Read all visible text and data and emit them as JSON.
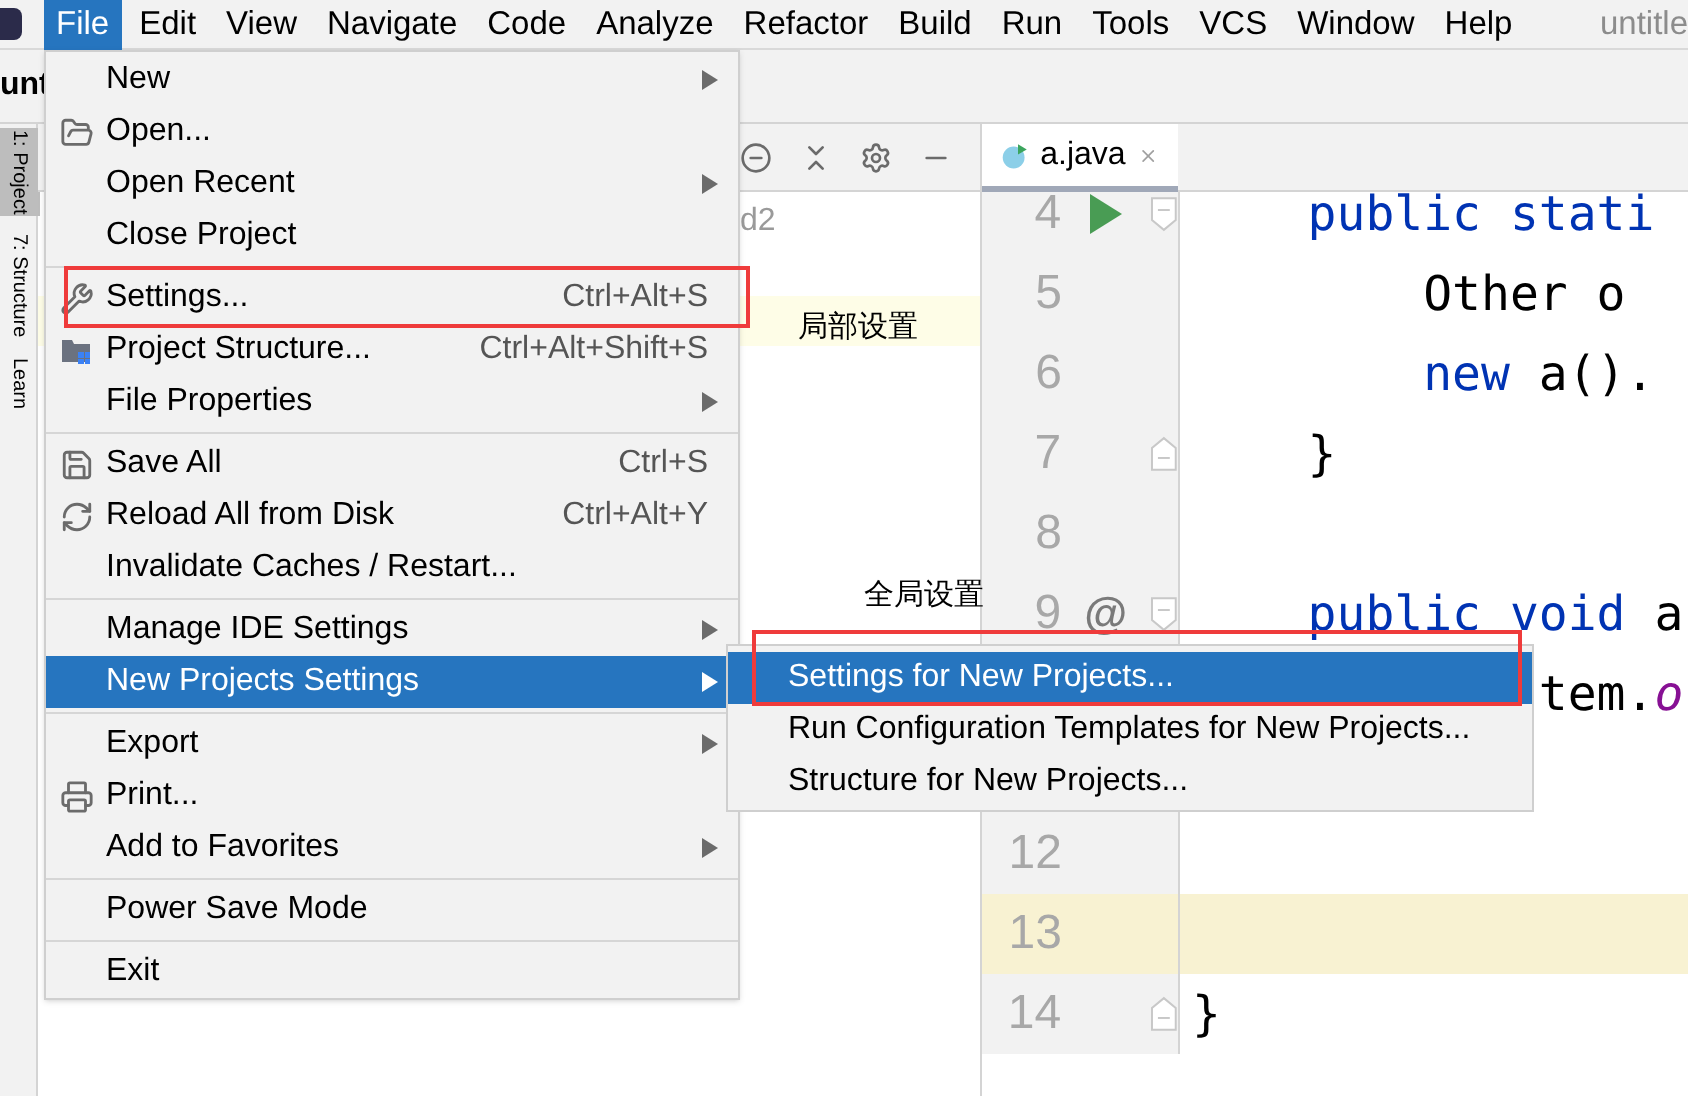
{
  "menubar": {
    "items": [
      {
        "label": "File",
        "selected": true
      },
      {
        "label": "Edit",
        "selected": false
      },
      {
        "label": "View",
        "selected": false
      },
      {
        "label": "Navigate",
        "selected": false
      },
      {
        "label": "Code",
        "selected": false
      },
      {
        "label": "Analyze",
        "selected": false
      },
      {
        "label": "Refactor",
        "selected": false
      },
      {
        "label": "Build",
        "selected": false
      },
      {
        "label": "Run",
        "selected": false
      },
      {
        "label": "Tools",
        "selected": false
      },
      {
        "label": "VCS",
        "selected": false
      },
      {
        "label": "Window",
        "selected": false
      },
      {
        "label": "Help",
        "selected": false
      }
    ],
    "window_title": "untitle"
  },
  "project_title": "unt",
  "tool_strip": [
    {
      "label": "1: Project",
      "selected": true
    },
    {
      "label": "7: Structure",
      "selected": false
    },
    {
      "label": "Learn",
      "selected": false
    }
  ],
  "project_panel": {
    "rows": [
      {
        "label": "d2",
        "highlighted": false
      },
      {
        "highlighted": false
      },
      {
        "highlighted": true
      }
    ]
  },
  "editor": {
    "tab": {
      "label": "a.java"
    },
    "lines": [
      {
        "number": "4",
        "kind": "run",
        "fold_start": true,
        "fold_end": false,
        "current": false,
        "tokens": [
          {
            "text": "    public stati",
            "kind": "keyword"
          }
        ]
      },
      {
        "number": "5",
        "kind": "plain",
        "fold_start": false,
        "fold_end": false,
        "current": false,
        "tokens": [
          {
            "text": "        Other o",
            "kind": "plain"
          }
        ]
      },
      {
        "number": "6",
        "kind": "plain",
        "fold_start": false,
        "fold_end": false,
        "current": false,
        "tokens": [
          {
            "text": "        new",
            "kind": "keyword"
          },
          {
            "text": " a().",
            "kind": "plain"
          }
        ]
      },
      {
        "number": "7",
        "kind": "plain",
        "fold_start": false,
        "fold_end": true,
        "current": false,
        "tokens": [
          {
            "text": "    }",
            "kind": "plain"
          }
        ]
      },
      {
        "number": "8",
        "kind": "plain",
        "fold_start": false,
        "fold_end": false,
        "current": false
      },
      {
        "number": "9",
        "kind": "override",
        "gutter_text": "@",
        "fold_start": true,
        "fold_end": false,
        "current": false,
        "tokens": [
          {
            "text": "    public void",
            "kind": "keyword"
          },
          {
            "text": " a",
            "kind": "plain"
          }
        ]
      },
      {
        "kind": "plain",
        "fold_start": false,
        "fold_end": false,
        "current": false,
        "tokens": [
          {
            "text": "            tem.",
            "kind": "plain"
          },
          {
            "text": "o",
            "kind": "field"
          }
        ]
      },
      {
        "kind": "plain",
        "fold_start": false,
        "fold_end": false,
        "current": false
      },
      {
        "number": "12",
        "kind": "plain",
        "fold_start": false,
        "fold_end": false,
        "current": false
      },
      {
        "number": "13",
        "kind": "plain",
        "fold_start": false,
        "fold_end": false,
        "current": true
      },
      {
        "number": "14",
        "kind": "plain",
        "fold_start": false,
        "fold_end": true,
        "current": false,
        "tokens": [
          {
            "text": "}",
            "kind": "plain"
          }
        ]
      }
    ]
  },
  "file_menu": {
    "groups": [
      [
        {
          "label": "New",
          "submenu": true,
          "selected": false
        },
        {
          "label": "Open...",
          "submenu": false,
          "selected": false
        },
        {
          "label": "Open Recent",
          "submenu": true,
          "selected": false
        },
        {
          "label": "Close Project",
          "submenu": false,
          "selected": false
        }
      ],
      [
        {
          "label": "Settings...",
          "shortcut": "Ctrl+Alt+S",
          "submenu": false,
          "selected": false
        },
        {
          "label": "Project Structure...",
          "shortcut": "Ctrl+Alt+Shift+S",
          "submenu": false,
          "selected": false
        },
        {
          "label": "File Properties",
          "submenu": true,
          "selected": false
        }
      ],
      [
        {
          "label": "Save All",
          "shortcut": "Ctrl+S",
          "submenu": false,
          "selected": false
        },
        {
          "label": "Reload All from Disk",
          "shortcut": "Ctrl+Alt+Y",
          "submenu": false,
          "selected": false
        },
        {
          "label": "Invalidate Caches / Restart...",
          "submenu": false,
          "selected": false
        }
      ],
      [
        {
          "label": "Manage IDE Settings",
          "submenu": true,
          "selected": false
        },
        {
          "label": "New Projects Settings",
          "submenu": true,
          "selected": true
        }
      ],
      [
        {
          "label": "Export",
          "submenu": true,
          "selected": false
        },
        {
          "label": "Print...",
          "submenu": false,
          "selected": false
        },
        {
          "label": "Add to Favorites",
          "submenu": true,
          "selected": false
        }
      ],
      [
        {
          "label": "Power Save Mode",
          "submenu": false,
          "selected": false
        }
      ],
      [
        {
          "label": "Exit",
          "submenu": false,
          "selected": false
        }
      ]
    ]
  },
  "submenu": {
    "items": [
      {
        "label": "Settings for New Projects...",
        "selected": true
      },
      {
        "label": "Run Configuration Templates for New Projects...",
        "selected": false
      },
      {
        "label": "Structure for New Projects...",
        "selected": false
      }
    ]
  },
  "annotations": [
    {
      "text": "局部设置"
    },
    {
      "text": "全局设置"
    }
  ]
}
